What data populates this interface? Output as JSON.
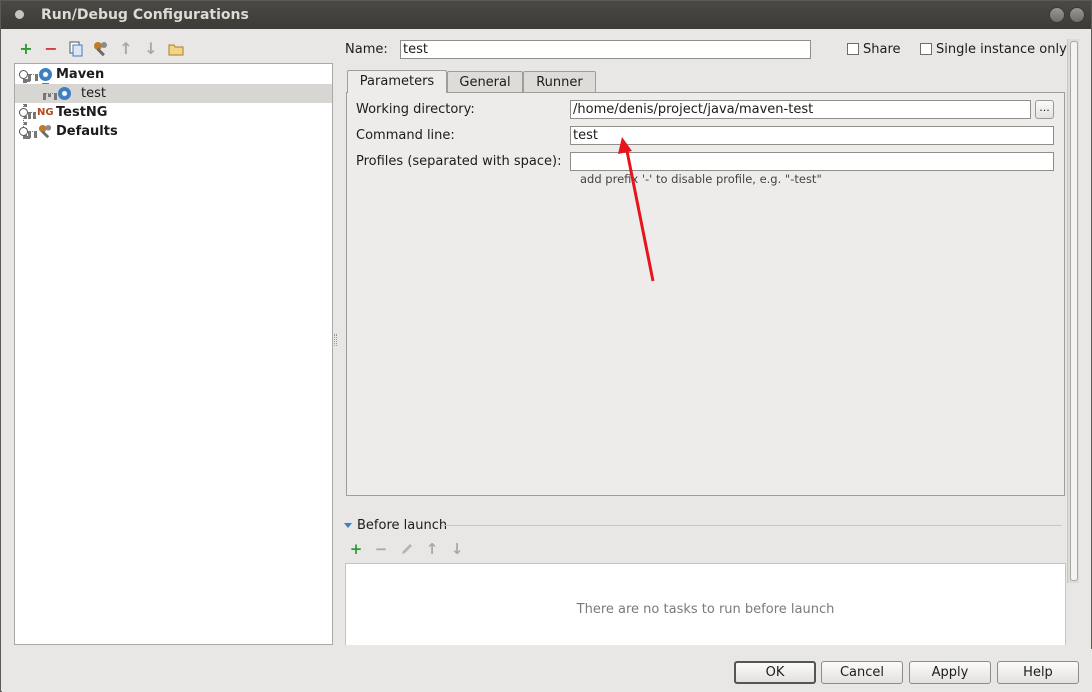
{
  "window": {
    "title": "Run/Debug Configurations"
  },
  "toolbar": {
    "add_icon": "+",
    "remove_icon": "−",
    "copy_icon": "copy-icon",
    "edit_defaults_icon": "wrench-icon",
    "move_up_icon": "↑",
    "move_down_icon": "↓",
    "folder_icon": "folder-icon"
  },
  "tree": {
    "items": [
      {
        "label": "Maven",
        "icon": "gear-icon"
      },
      {
        "label": "test",
        "icon": "gear-icon",
        "selected": true
      },
      {
        "label": "TestNG",
        "icon": "testng-icon"
      },
      {
        "label": "Defaults",
        "icon": "wrench-icon"
      }
    ]
  },
  "name_field": {
    "label": "Name:",
    "value": "test"
  },
  "share": {
    "label": "Share",
    "checked": false
  },
  "single_instance": {
    "label": "Single instance only",
    "checked": false
  },
  "tabs": [
    {
      "label": "Parameters",
      "active": true
    },
    {
      "label": "General",
      "active": false
    },
    {
      "label": "Runner",
      "active": false
    }
  ],
  "parameters": {
    "working_directory": {
      "label": "Working directory:",
      "value": "/home/denis/project/java/maven-test",
      "browse_label": "..."
    },
    "command_line": {
      "label": "Command line:",
      "value": "test"
    },
    "profiles": {
      "label": "Profiles (separated with space):",
      "value": "",
      "hint": "add prefix '-' to disable profile, e.g. \"-test\""
    }
  },
  "before_launch": {
    "title": "Before launch",
    "empty_message": "There are no tasks to run before launch"
  },
  "buttons": {
    "ok": "OK",
    "cancel": "Cancel",
    "apply": "Apply",
    "help": "Help"
  },
  "colors": {
    "accent_blue": "#3b7fc4",
    "add_green": "#2d9c2d",
    "remove_red": "#d03a3a",
    "annotation_arrow": "#e8141c"
  }
}
